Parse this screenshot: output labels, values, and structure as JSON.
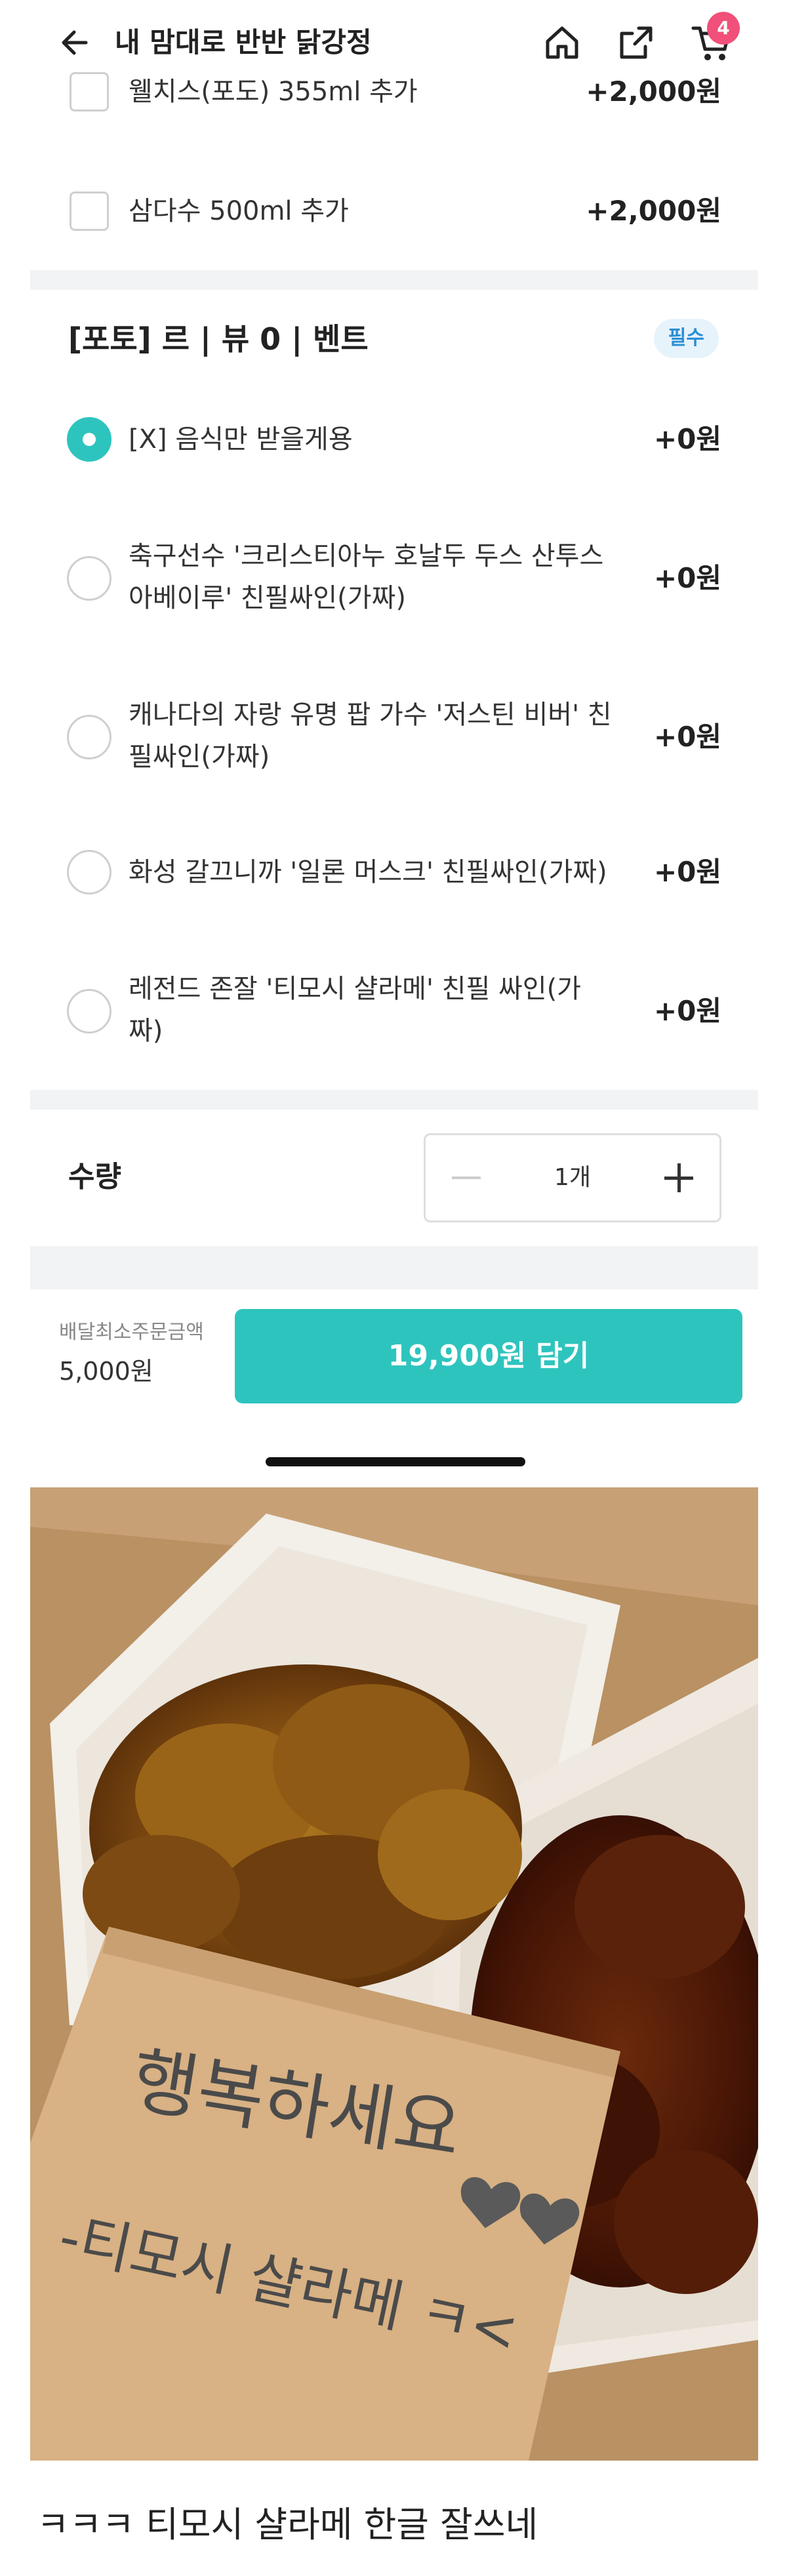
{
  "header": {
    "title": "내 맘대로 반반 닭강정",
    "cart_count": "4"
  },
  "drink_options": [
    {
      "label": "웰치스(포도) 355ml 추가",
      "price": "+2,000원",
      "checked": false
    },
    {
      "label": "삼다수 500ml 추가",
      "price": "+2,000원",
      "checked": false
    }
  ],
  "review_event": {
    "title": "[포토] 르 | 뷰 0 |  벤트",
    "badge": "필수",
    "options": [
      {
        "label": "[X] 음식만 받을게용",
        "price": "+0원",
        "selected": true
      },
      {
        "label_line1": "축구선수 '크리스티아누 호날두 두스 산투스",
        "label_line2": "아베이루' 친필싸인(가짜)",
        "price": "+0원",
        "selected": false
      },
      {
        "label_line1": "캐나다의 자랑 유명 팝 가수 '저스틴 비버' 친",
        "label_line2": "필싸인(가짜)",
        "price": "+0원",
        "selected": false
      },
      {
        "label": "화성 갈끄니까 '일론 머스크' 친필싸인(가짜)",
        "price": "+0원",
        "selected": false
      },
      {
        "label_line1": "레전드 존잘 '티모시 샬라메' 친필 싸인(가",
        "label_line2": "짜)",
        "price": "+0원",
        "selected": false
      }
    ]
  },
  "quantity": {
    "label": "수량",
    "value": "1개"
  },
  "bottom_bar": {
    "min_order_label": "배달최소주문금액",
    "min_order_value": "5,000원",
    "cta_label": "19,900원 담기"
  },
  "photo": {
    "note_line1": "행복하세요",
    "note_line2": "-티모시 샬라메 ㅋ<"
  },
  "caption": "ㅋㅋㅋ 티모시 샬라메  한글 잘쓰네",
  "colors": {
    "accent": "#2ec4be",
    "badge_bg": "#e7f3fb",
    "badge_text": "#2a8fd6",
    "cart_badge": "#f0507a",
    "divider": "#f2f3f5"
  }
}
